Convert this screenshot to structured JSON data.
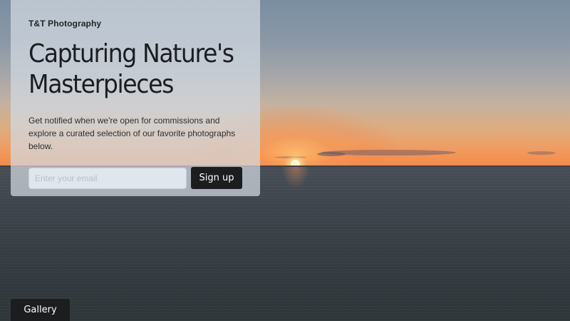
{
  "brand": {
    "name": "T&T Photography"
  },
  "hero": {
    "headline": "Capturing Nature's Masterpieces",
    "lead": "Get notified when we're open for commissions and explore a curated selection of our favorite photographs below."
  },
  "signup": {
    "email_placeholder": "Enter your email",
    "email_value": "",
    "button_label": "Sign up"
  },
  "nav": {
    "gallery_label": "Gallery"
  },
  "background": {
    "description_icon": "sunset-over-sea-photo"
  },
  "colors": {
    "button_bg": "#1c1d1f",
    "card_bg": "#d2dae2"
  }
}
